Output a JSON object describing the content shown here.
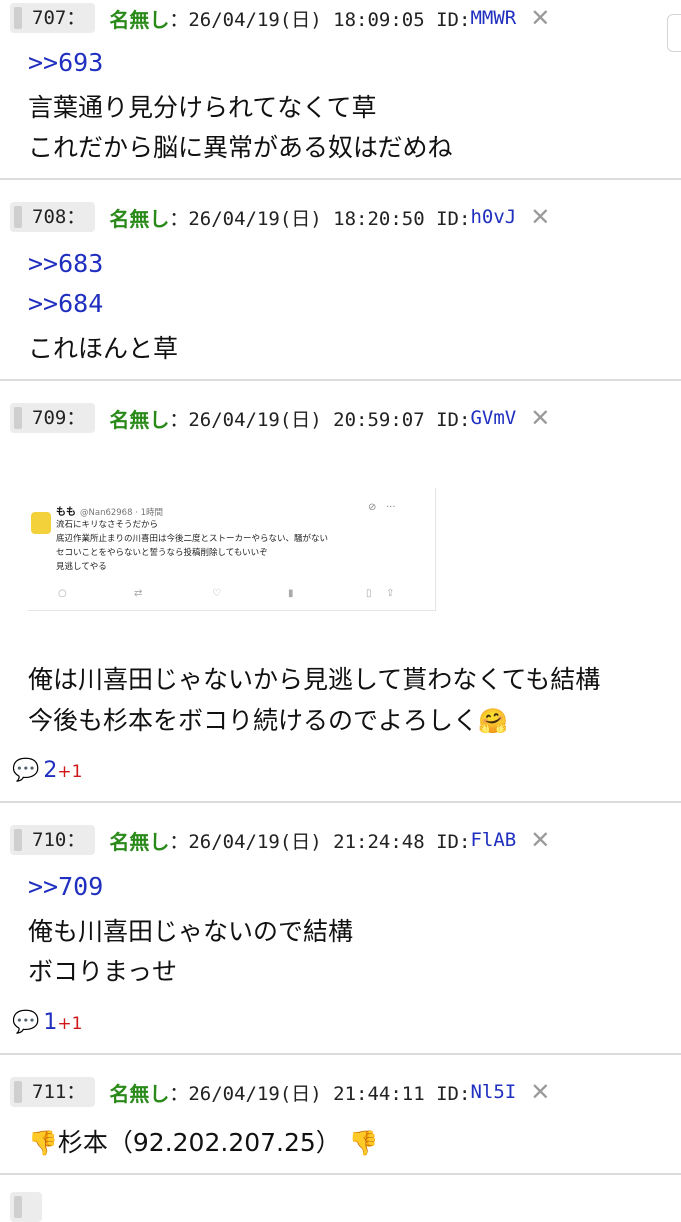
{
  "posts": [
    {
      "number": "707：",
      "name": "名無し",
      "datetime": "：26/04/19(日) 18:09:05 ID:",
      "id": "MMWR",
      "anchors": [
        ">>693"
      ],
      "lines": [
        "言葉通り見分けられてなくて草",
        "これだから脳に異常がある奴はだめね"
      ]
    },
    {
      "number": "708：",
      "name": "名無し",
      "datetime": "：26/04/19(日) 18:20:50 ID:",
      "id": "h0vJ",
      "anchors": [
        ">>683",
        ">>684"
      ],
      "lines": [
        "これほんと草"
      ]
    },
    {
      "number": "709：",
      "name": "名無し",
      "datetime": "：26/04/19(日) 20:59:07 ID:",
      "id": "GVmV",
      "lines": [
        "俺は川喜田じゃないから見逃して貰わなくても結構",
        "今後も杉本をボコり続けるのでよろしく"
      ],
      "emoji_hug": "🤗",
      "replies": {
        "count": "2",
        "plus": "+1"
      },
      "tweet": {
        "user": "もも",
        "handle": "@Nan62968 · 1時間",
        "lines": [
          "流石にキリなさそうだから",
          "底辺作業所止まりの川喜田は今後二度とストーカーやらない、騒がない",
          "セコいことをやらないと誓うなら投稿削除してもいいぞ",
          "見逃してやる"
        ]
      }
    },
    {
      "number": "710：",
      "name": "名無し",
      "datetime": "：26/04/19(日) 21:24:48 ID:",
      "id": "FlAB",
      "anchors": [
        ">>709"
      ],
      "lines": [
        "俺も川喜田じゃないので結構",
        "ボコりまっせ"
      ],
      "replies": {
        "count": "1",
        "plus": "+1"
      }
    },
    {
      "number": "711：",
      "name": "名無し",
      "datetime": "：26/04/19(日) 21:44:11 ID:",
      "id": "Nl5I",
      "emoji_down": "👎",
      "text": "杉本（92.202.207.25）"
    }
  ],
  "icons": {
    "close": "✕",
    "reply": "💬"
  }
}
